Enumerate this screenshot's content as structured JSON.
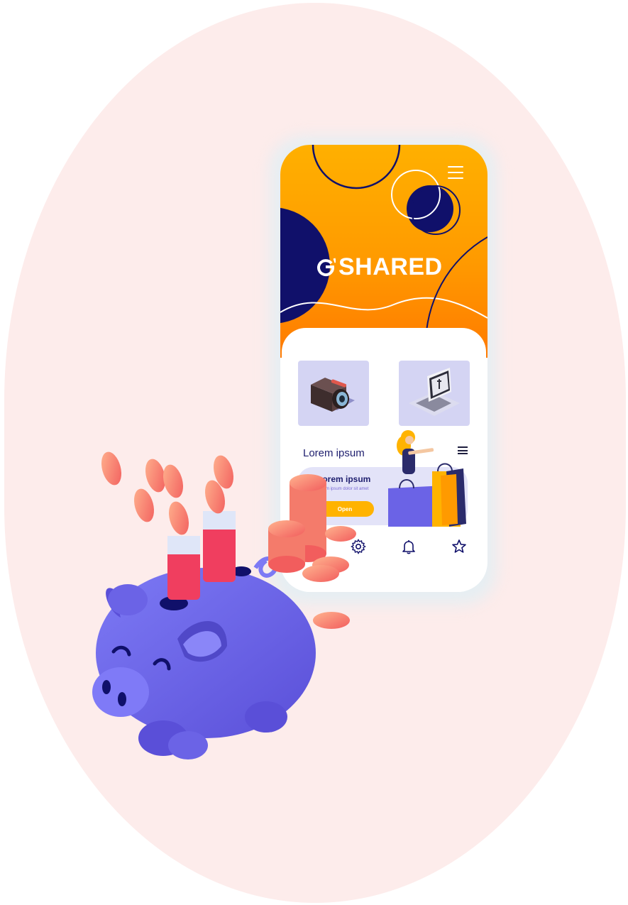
{
  "brand": {
    "name": "SHARED"
  },
  "icons": {
    "menu": "hamburger-icon",
    "brand_mark": "brand-logo-icon",
    "video_camera": "video-camera-icon",
    "laptop": "laptop-icon",
    "list_menu": "list-menu-icon",
    "settings": "gear-icon",
    "notifications": "bell-icon",
    "favorites": "star-icon"
  },
  "main": {
    "section_title": "Lorem ipsum",
    "promo": {
      "title": "Lorem ipsum",
      "subtitle": "Lorem ipsum dolor sit amet",
      "button_label": "Open"
    }
  },
  "colors": {
    "accent_orange": "#ff9a00",
    "accent_yellow": "#ffb300",
    "navy": "#10106a",
    "tile_lavender": "#d4d4f3",
    "piggy_purple": "#6b63e6",
    "coin_salmon": "#f47b6b",
    "background_pink": "#fdeceb"
  }
}
